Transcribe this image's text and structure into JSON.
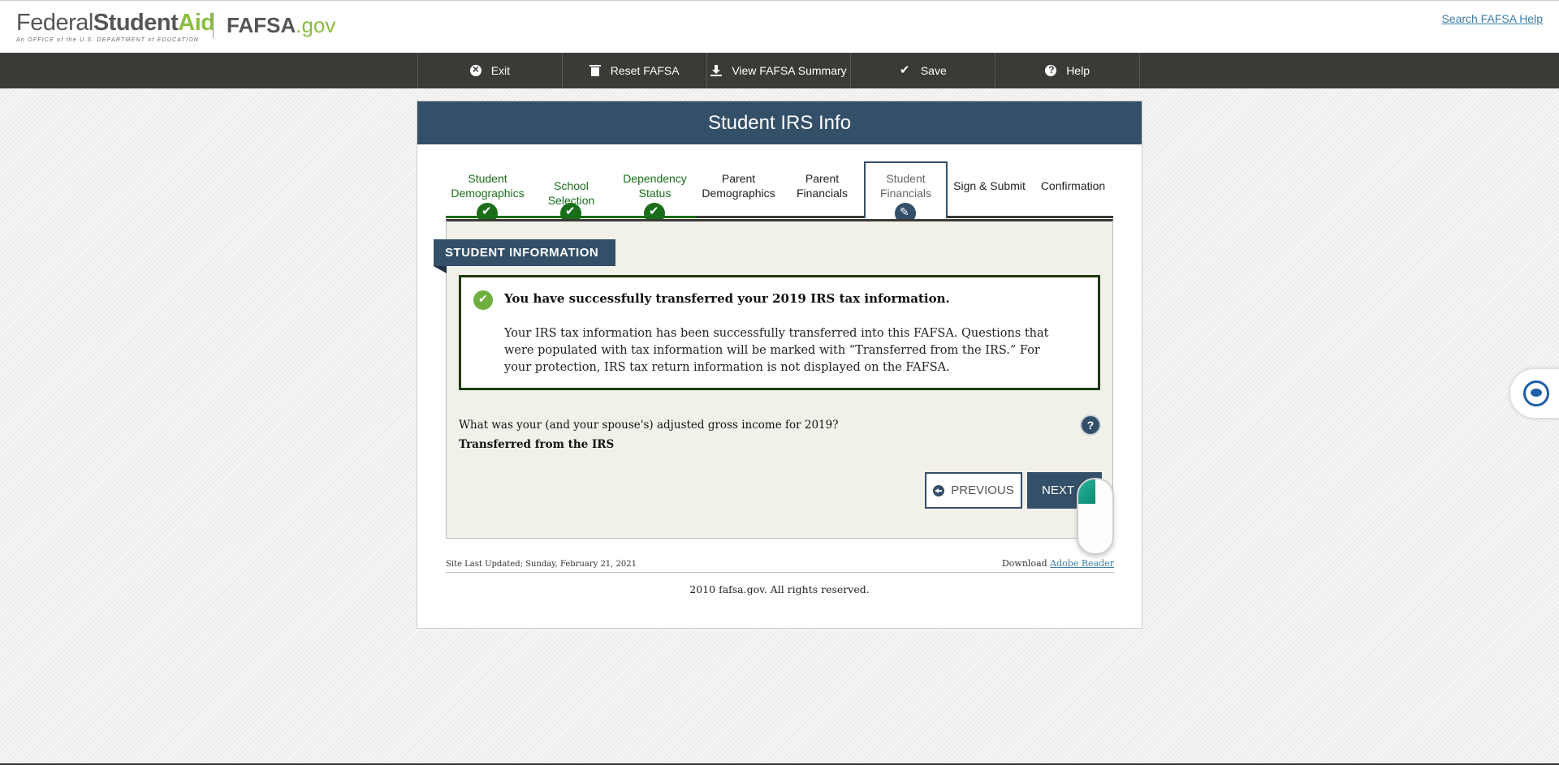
{
  "header": {
    "logo_federal": "Federal",
    "logo_student": "Student",
    "logo_aid": "Aid",
    "logo_sub": "An OFFICE of the U.S. DEPARTMENT of EDUCATION",
    "logo_fafsa": "FAFSA",
    "logo_gov": ".gov",
    "search_help": "Search FAFSA Help"
  },
  "nav": {
    "exit": "Exit",
    "reset": "Reset FAFSA",
    "view_summary": "View FAFSA Summary",
    "save": "Save",
    "help": "Help"
  },
  "panel": {
    "title": "Student IRS Info"
  },
  "steps": [
    {
      "label": "Student Demographics",
      "status": "done"
    },
    {
      "label": "School Selection",
      "status": "done"
    },
    {
      "label": "Dependency Status",
      "status": "done"
    },
    {
      "label": "Parent Demographics",
      "status": "todo"
    },
    {
      "label": "Parent Financials",
      "status": "todo"
    },
    {
      "label": "Student Financials",
      "status": "current"
    },
    {
      "label": "Sign & Submit",
      "status": "todo"
    },
    {
      "label": "Confirmation",
      "status": "todo"
    }
  ],
  "section": {
    "tag": "STUDENT INFORMATION"
  },
  "success": {
    "heading": "You have successfully transferred your 2019 IRS tax information.",
    "body": "Your IRS tax information has been successfully transferred into this FAFSA. Questions that were populated with tax information will be marked with “Transferred from the IRS.” For your protection, IRS tax return information is not displayed on the FAFSA."
  },
  "question": {
    "text": "What was your (and your spouse's) adjusted gross income for 2019?",
    "answer": "Transferred from the IRS",
    "help_label": "?"
  },
  "buttons": {
    "previous": "PREVIOUS",
    "next": "NEXT"
  },
  "footer": {
    "site_updated": "Site Last Updated: Sunday, February 21, 2021",
    "download_prefix": "Download ",
    "download_link": "Adobe Reader",
    "copyright": "2010 fafsa.gov. All rights reserved."
  },
  "colors": {
    "primary": "#344f68",
    "success_green": "#1a6e1a",
    "accent_green": "#8bbd3f",
    "nav_bg": "#3b3a36"
  }
}
